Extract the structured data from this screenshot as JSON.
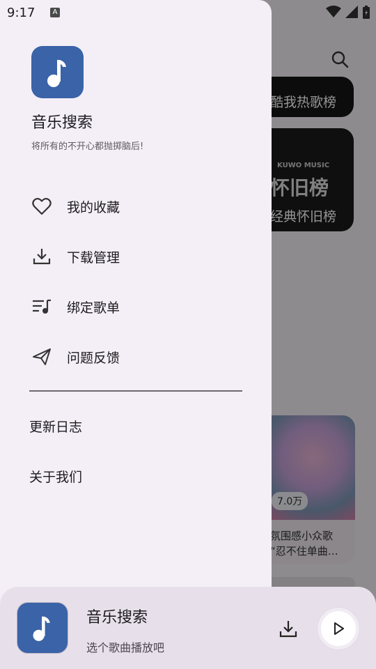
{
  "status_bar": {
    "time": "9:17",
    "notif_icon_letter": "A"
  },
  "background": {
    "card1_title": "酷我热歌榜",
    "card2_overlay": "怀旧榜",
    "card2_brand": "KUWO MUSIC",
    "card2_title": "经典怀旧榜",
    "card3_play_count": "7.0万",
    "card3_line1": "氛围感小众歌",
    "card3_line2": "“忍不住单曲…"
  },
  "drawer": {
    "app_name": "音乐搜索",
    "slogan": "将所有的不开心都抛掷脑后!",
    "menu": [
      {
        "label": "我的收藏",
        "icon": "heart-icon"
      },
      {
        "label": "下载管理",
        "icon": "download-icon"
      },
      {
        "label": "绑定歌单",
        "icon": "playlist-icon"
      },
      {
        "label": "问题反馈",
        "icon": "send-icon"
      }
    ],
    "extra": [
      {
        "label": "更新日志"
      },
      {
        "label": "关于我们"
      }
    ]
  },
  "player": {
    "title": "音乐搜索",
    "subtitle": "选个歌曲播放吧"
  },
  "colors": {
    "accent": "#3a63a8",
    "drawer_bg": "#f4eff6",
    "player_bg": "#e7e0ea"
  }
}
